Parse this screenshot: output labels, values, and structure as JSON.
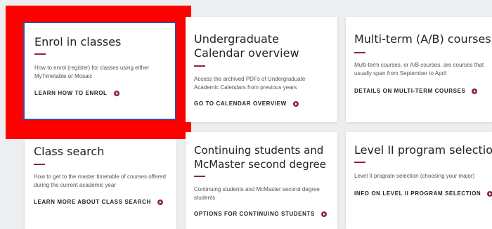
{
  "colors": {
    "accent": "#8b2742",
    "highlight": "#ff0000",
    "background": "#eceeef"
  },
  "cards": [
    {
      "title": "Enrol in classes",
      "description": "How to enrol (register) for classes using either MyTimetable or Mosaic",
      "link": "LEARN HOW TO ENROL"
    },
    {
      "title": "Undergraduate Calendar overview",
      "description": "Access the archived PDFs of Undergraduate Academic Calendars from previous years",
      "link": "GO TO CALENDAR OVERVIEW"
    },
    {
      "title": "Multi-term (A/B) courses",
      "description": "Multi-term courses, or A/B courses, are courses that usually span from September to April",
      "link": "DETAILS ON MULTI-TERM COURSES"
    },
    {
      "title": "Class search",
      "description": "How to get to the master timetable of courses offered during the current academic year",
      "link": "LEARN MORE ABOUT CLASS SEARCH"
    },
    {
      "title": "Continuing students and McMaster second degree",
      "description": "Continuing students and McMaster second degree students",
      "link": "OPTIONS FOR CONTINUING STUDENTS"
    },
    {
      "title": "Level II program selection",
      "description": "Level II program selection (choosing your major)",
      "link": "INFO ON LEVEL II PROGRAM SELECTION"
    }
  ]
}
